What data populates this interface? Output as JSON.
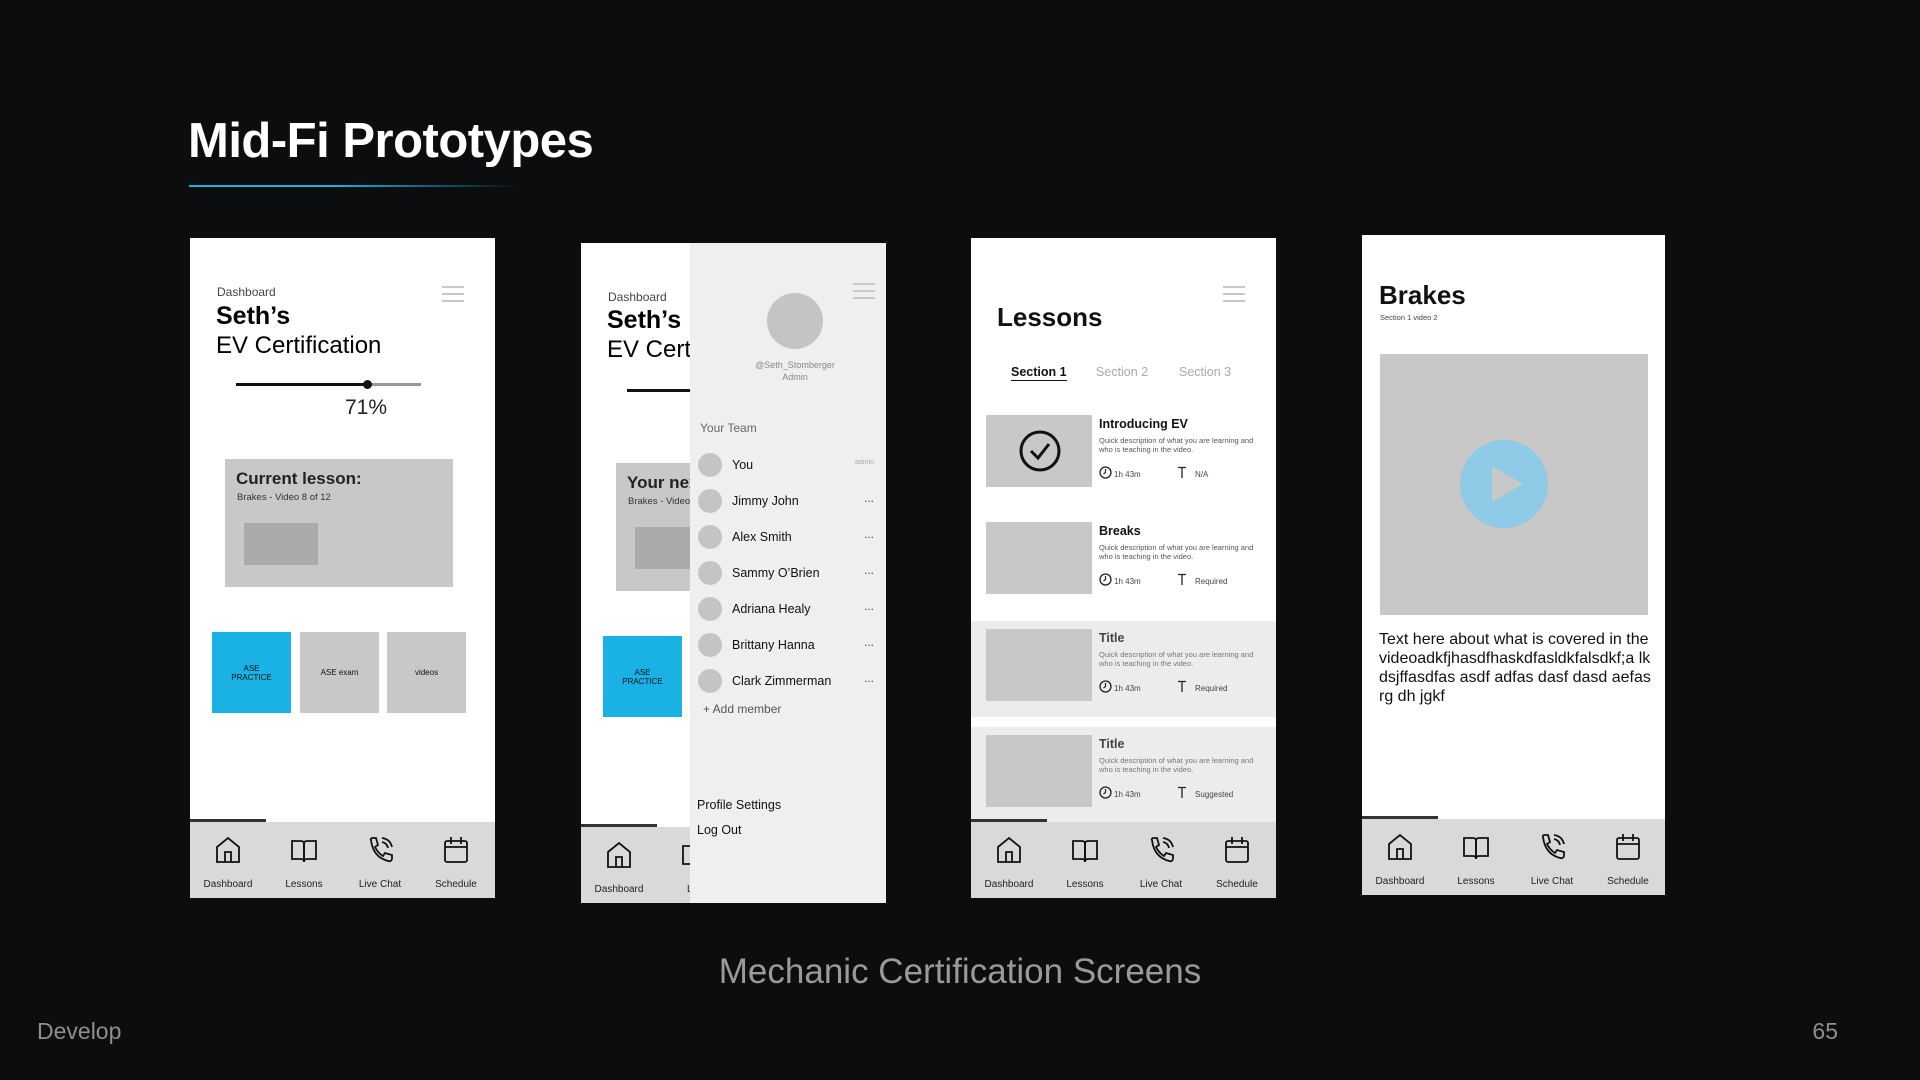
{
  "slide": {
    "title": "Mid-Fi Prototypes",
    "caption": "Mechanic Certification Screens",
    "section": "Develop",
    "page_number": "65",
    "accent": "#1ab2e4"
  },
  "nav": [
    "Dashboard",
    "Lessons",
    "Live Chat",
    "Schedule"
  ],
  "phone1": {
    "header": "Dashboard",
    "name": "Seth’s",
    "subtitle": "EV Certification",
    "progress": 0.71,
    "progress_label": "71%",
    "current_lesson_title": "Current lesson:",
    "current_lesson_sub": "Brakes - Video 8 of 12",
    "tiles": [
      "ASE PRACTICE",
      "ASE exam",
      "videos"
    ]
  },
  "phone2": {
    "header": "Dashboard",
    "name": "Seth’s",
    "subtitle_cut": "EV Cert",
    "card_title_cut": "Your nex",
    "card_sub_cut": "Brakes - Video",
    "tile": "ASE PRACTICE",
    "nav_cut": [
      "Dashboard",
      "Les"
    ],
    "handle": "@Seth_Stomberger",
    "role": "Admin",
    "team_label": "Your Team",
    "team": [
      {
        "name": "You",
        "meta": "admin"
      },
      {
        "name": "Jimmy John",
        "meta": "..."
      },
      {
        "name": "Alex Smith",
        "meta": "..."
      },
      {
        "name": "Sammy O’Brien",
        "meta": "..."
      },
      {
        "name": "Adriana Healy",
        "meta": "..."
      },
      {
        "name": "Brittany Hanna",
        "meta": "..."
      },
      {
        "name": "Clark Zimmerman",
        "meta": "..."
      }
    ],
    "add_member": "+ Add member",
    "profile_settings": "Profile Settings",
    "log_out": "Log Out"
  },
  "phone3": {
    "title": "Lessons",
    "tabs": [
      "Section 1",
      "Section 2",
      "Section 3"
    ],
    "active_tab": 0,
    "lessons": [
      {
        "title": "Introducing EV",
        "desc": "Quick description of what you are learning and who is teaching in the video.",
        "duration": "1h 43m",
        "status": "N/A",
        "completed": true
      },
      {
        "title": "Breaks",
        "desc": "Quick description of what you are learning and who is teaching in the video.",
        "duration": "1h 43m",
        "status": "Required",
        "completed": false
      },
      {
        "title": "Title",
        "desc": "Quick description of what you are learning and who is teaching in the video.",
        "duration": "1h 43m",
        "status": "Required",
        "completed": false
      },
      {
        "title": "Title",
        "desc": "Quick description of what you are learning and who is teaching in the video.",
        "duration": "1h 43m",
        "status": "Suggested",
        "completed": false
      }
    ]
  },
  "phone4": {
    "title": "Brakes",
    "subtitle": "Section 1 video 2",
    "body": "Text here about what is covered in the videoadkfjhasdfhaskdfasldkfalsdkf;a lkdsjffasdfas asdf adfas dasf dasd aefasrg dh jgkf",
    "play_color": "#8ecae6"
  }
}
